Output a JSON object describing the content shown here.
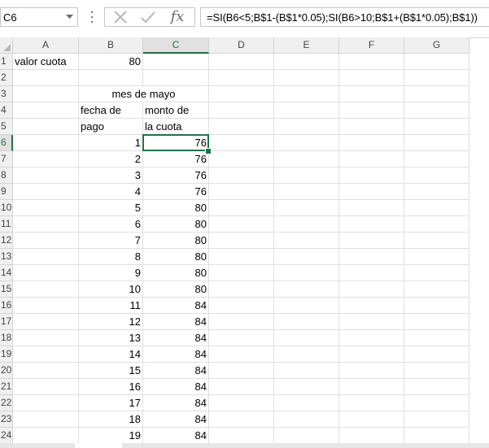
{
  "formula_bar": {
    "name_box": "C6",
    "formula": "=SI(B6<5;B$1-(B$1*0.05);SI(B6>10;B$1+(B$1*0.05);B$1))",
    "icons": {
      "dropdown": "chevron-down-icon",
      "cancel": "close-icon",
      "enter": "checkmark-icon",
      "insert_function": "fx-icon"
    },
    "fx_label": "fx"
  },
  "sheet": {
    "columns": [
      "A",
      "B",
      "C",
      "D",
      "E",
      "F",
      "G"
    ],
    "selected_column": "C",
    "selected_row": "6",
    "rows": [
      {
        "row": "1",
        "A": "valor cuota",
        "B": "80",
        "C": ""
      },
      {
        "row": "2",
        "A": "",
        "B": "",
        "C": ""
      },
      {
        "row": "3",
        "A": "",
        "B": "mes de mayo",
        "C": ""
      },
      {
        "row": "4",
        "A": "",
        "B": "fecha de",
        "C": "monto de"
      },
      {
        "row": "5",
        "A": "",
        "B": "pago",
        "C": "la cuota"
      },
      {
        "row": "6",
        "A": "",
        "B": "1",
        "C": "76"
      },
      {
        "row": "7",
        "A": "",
        "B": "2",
        "C": "76"
      },
      {
        "row": "8",
        "A": "",
        "B": "3",
        "C": "76"
      },
      {
        "row": "9",
        "A": "",
        "B": "4",
        "C": "76"
      },
      {
        "row": "10",
        "A": "",
        "B": "5",
        "C": "80"
      },
      {
        "row": "11",
        "A": "",
        "B": "6",
        "C": "80"
      },
      {
        "row": "12",
        "A": "",
        "B": "7",
        "C": "80"
      },
      {
        "row": "13",
        "A": "",
        "B": "8",
        "C": "80"
      },
      {
        "row": "14",
        "A": "",
        "B": "9",
        "C": "80"
      },
      {
        "row": "15",
        "A": "",
        "B": "10",
        "C": "80"
      },
      {
        "row": "16",
        "A": "",
        "B": "11",
        "C": "84"
      },
      {
        "row": "17",
        "A": "",
        "B": "12",
        "C": "84"
      },
      {
        "row": "18",
        "A": "",
        "B": "13",
        "C": "84"
      },
      {
        "row": "19",
        "A": "",
        "B": "14",
        "C": "84"
      },
      {
        "row": "20",
        "A": "",
        "B": "15",
        "C": "84"
      },
      {
        "row": "21",
        "A": "",
        "B": "16",
        "C": "84"
      },
      {
        "row": "22",
        "A": "",
        "B": "17",
        "C": "84"
      },
      {
        "row": "23",
        "A": "",
        "B": "18",
        "C": "84"
      },
      {
        "row": "24",
        "A": "",
        "B": "19",
        "C": "84"
      }
    ]
  },
  "colors": {
    "accent": "#217346",
    "header_bg": "#f0f0f0",
    "gridline": "#e0e0e0"
  }
}
